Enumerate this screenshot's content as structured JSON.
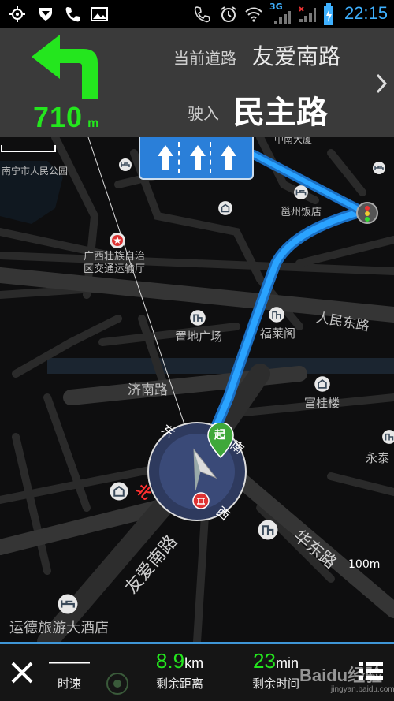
{
  "status_bar": {
    "time": "22:15",
    "network": "3G",
    "icons": [
      "gps-icon",
      "shield-icon",
      "phone-icon",
      "image-icon",
      "phone-call-icon",
      "alarm-icon",
      "wifi-icon",
      "signal-3g-icon",
      "signal-icon",
      "battery-charging-icon"
    ]
  },
  "navigation": {
    "turn_direction": "turn-left-icon",
    "distance_value": "710",
    "distance_unit": "m",
    "current_road_label": "当前道路",
    "current_road": "友爱南路",
    "enter_label": "驶入",
    "next_road": "民主路",
    "lanes": [
      "straight",
      "straight",
      "straight"
    ]
  },
  "map": {
    "labels": {
      "park": "南宁市人民公园",
      "top_street": "中南大厦",
      "hotel1": "邕州饭店",
      "traffic_office": "广西壮族自治\n区交通运输厅",
      "renmin_road": "人民东路",
      "zhidi": "置地广场",
      "fulai": "福莱阁",
      "jinan_road": "济南路",
      "fugui": "富桂楼",
      "yongtai": "永泰",
      "youai_road": "友爱南路",
      "huadong_road": "华东路",
      "yunde_hotel": "运德旅游大酒店"
    },
    "compass": {
      "east": "东",
      "south": "南",
      "west": "西",
      "north": "北"
    },
    "start_marker": "起",
    "scale": "100m"
  },
  "bottom_bar": {
    "speed_value": "——",
    "speed_label": "时速",
    "remaining_distance_value": "8.9",
    "remaining_distance_unit": "km",
    "remaining_distance_label": "剩余距离",
    "remaining_time_value": "23",
    "remaining_time_unit": "min",
    "remaining_time_label": "剩余时间",
    "watermark": "Baidu经验",
    "watermark_sub": "jingyan.baidu.com"
  },
  "colors": {
    "accent_green": "#24e61e",
    "route_blue": "#2aa3ff",
    "time_blue": "#3fb1ff",
    "header_gray": "#3a3a3a"
  }
}
